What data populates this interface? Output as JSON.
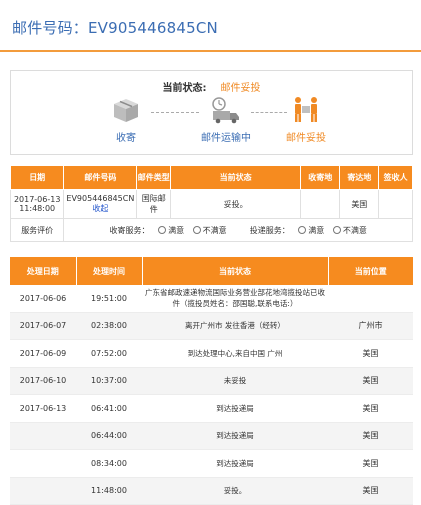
{
  "header": {
    "title": "邮件号码：EV905446845CN"
  },
  "status": {
    "label": "当前状态:",
    "value": "邮件妥投",
    "steps": [
      {
        "label": "收寄",
        "icon": "package-icon"
      },
      {
        "label": "邮件运输中",
        "icon": "truck-icon"
      },
      {
        "label": "邮件妥投",
        "icon": "delivery-person-icon"
      }
    ]
  },
  "colors": {
    "accent": "#f68b1f",
    "link": "#3b6db3"
  },
  "summary_table": {
    "headers": [
      "日期",
      "邮件号码",
      "邮件类型",
      "当前状态",
      "收寄地",
      "寄达地",
      "签收人"
    ],
    "row": {
      "date": "2017-06-13 11:48:00",
      "number": "EV905446845CN",
      "subscribe": "收起",
      "type": "国际邮件",
      "status": "妥投。",
      "from": "",
      "to": "美国",
      "signer": ""
    },
    "rating": {
      "label": "服务评价",
      "mailing_label": "收寄服务：",
      "delivery_label": "投递服务：",
      "satisfied": "满意",
      "unsatisfied": "不满意"
    }
  },
  "detail_table": {
    "headers": [
      "处理日期",
      "处理时间",
      "当前状态",
      "当前位置"
    ],
    "rows": [
      {
        "date": "2017-06-06",
        "time": "19:51:00",
        "status": "广东省邮政速递物流国际业务营业部花地湾揽投站已收件（揽投员姓名：邵国聪,联系电话:）",
        "location": ""
      },
      {
        "date": "2017-06-07",
        "time": "02:38:00",
        "status": "离开广州市 发往香港（经转）",
        "location": "广州市"
      },
      {
        "date": "2017-06-09",
        "time": "07:52:00",
        "status": "到达处理中心,来自中国 广州",
        "location": "美国"
      },
      {
        "date": "2017-06-10",
        "time": "10:37:00",
        "status": "未妥投",
        "location": "美国"
      },
      {
        "date": "2017-06-13",
        "time": "06:41:00",
        "status": "到达投递局",
        "location": "美国"
      },
      {
        "date": "",
        "time": "06:44:00",
        "status": "到达投递局",
        "location": "美国"
      },
      {
        "date": "",
        "time": "08:34:00",
        "status": "到达投递局",
        "location": "美国"
      },
      {
        "date": "",
        "time": "11:48:00",
        "status": "妥投。",
        "location": "美国"
      }
    ]
  }
}
